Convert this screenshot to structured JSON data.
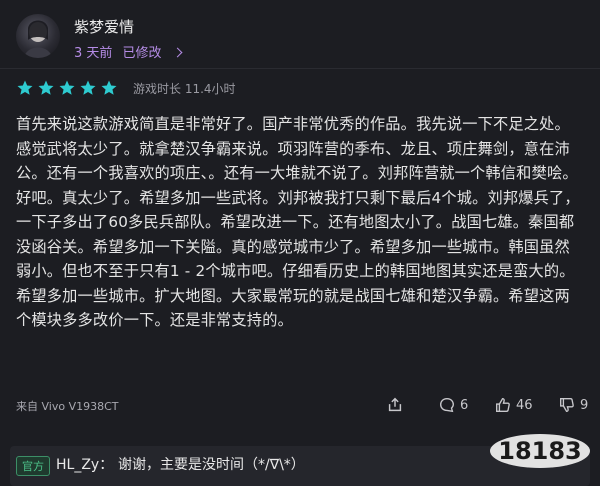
{
  "user": {
    "name": "紫梦爱情",
    "time": "3 天前",
    "edited": "已修改"
  },
  "rating": {
    "stars": 5,
    "max": 5,
    "star_color": "#2ecbd0",
    "playtime_label": "游戏时长 11.4小时"
  },
  "review_text": "首先来说这款游戏简直是非常好了。国产非常优秀的作品。我先说一下不足之处。感觉武将太少了。就拿楚汉争霸来说。项羽阵营的季布、龙且、项庄舞剑，意在沛公。还有一个我喜欢的项庄、。还有一大堆就不说了。刘邦阵营就一个韩信和樊哙。好吧。真太少了。希望多加一些武将。刘邦被我打只剩下最后4个城。刘邦爆兵了，一下子多出了60多民兵部队。希望改进一下。还有地图太小了。战国七雄。秦国都没函谷关。希望多加一下关隘。真的感觉城市少了。希望多加一些城市。韩国虽然弱小。但也不至于只有1 - 2个城市吧。仔细看历史上的韩国地图其实还是蛮大的。希望多加一些城市。扩大地图。大家最常玩的就是战国七雄和楚汉争霸。希望这两个模块多多改价一下。还是非常支持的。",
  "footer": {
    "device": "来自 Vivo V1938CT",
    "comments": "6",
    "likes": "46",
    "dislikes": "9"
  },
  "reply": {
    "badge": "官方",
    "name": "HL_Zy：",
    "text": "谢谢，主要是没时间（*/∇\\*）"
  },
  "watermark": {
    "text": "18183"
  }
}
